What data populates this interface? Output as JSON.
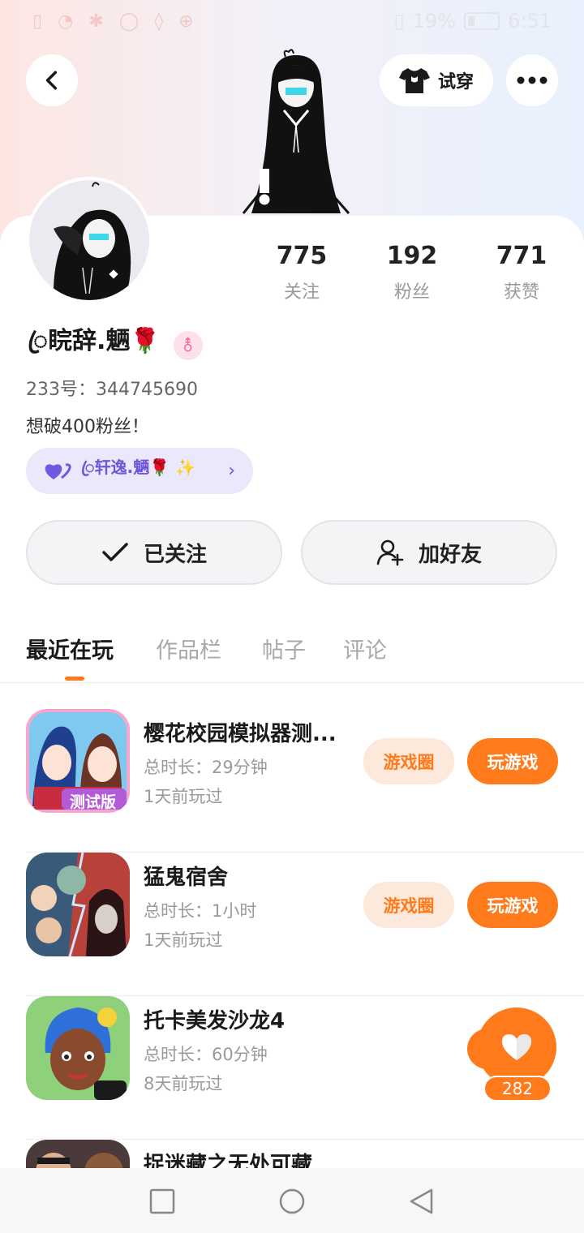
{
  "status_bar": {
    "battery": "19%",
    "time": "6:51"
  },
  "header": {
    "tryon_label": "试穿"
  },
  "profile": {
    "stats": [
      {
        "value": "775",
        "label": "关注"
      },
      {
        "value": "192",
        "label": "粉丝"
      },
      {
        "value": "771",
        "label": "获赞"
      }
    ],
    "nickname": "ꦿ睆辞.魉🌹",
    "gender_symbol": "⚨",
    "uid": "233号：344745690",
    "bio": "想破400粉丝！",
    "relation_name": "ꦿ轩逸.魉🌹 ✨"
  },
  "actions": {
    "follow_label": "已关注",
    "friend_label": "加好友"
  },
  "tabs": [
    "最近在玩",
    "作品栏",
    "帖子",
    "评论"
  ],
  "games": [
    {
      "name": "樱花校园模拟器测...",
      "duration": "总时长：29分钟",
      "last_played": "1天前玩过",
      "circle_label": "游戏圈",
      "play_label": "玩游戏",
      "icon_badge": "测试版"
    },
    {
      "name": "猛鬼宿舍",
      "duration": "总时长：1小时",
      "last_played": "1天前玩过",
      "circle_label": "游戏圈",
      "play_label": "玩游戏"
    },
    {
      "name": "托卡美发沙龙4",
      "duration": "总时长：60分钟",
      "last_played": "8天前玩过"
    },
    {
      "name": "捉迷藏之无处可藏"
    }
  ],
  "like_count": "282",
  "colors": {
    "accent": "#ff7a1a",
    "accent_light": "#fde8dc",
    "chip_bg": "#ece8fb",
    "chip_text": "#6d56d8"
  }
}
